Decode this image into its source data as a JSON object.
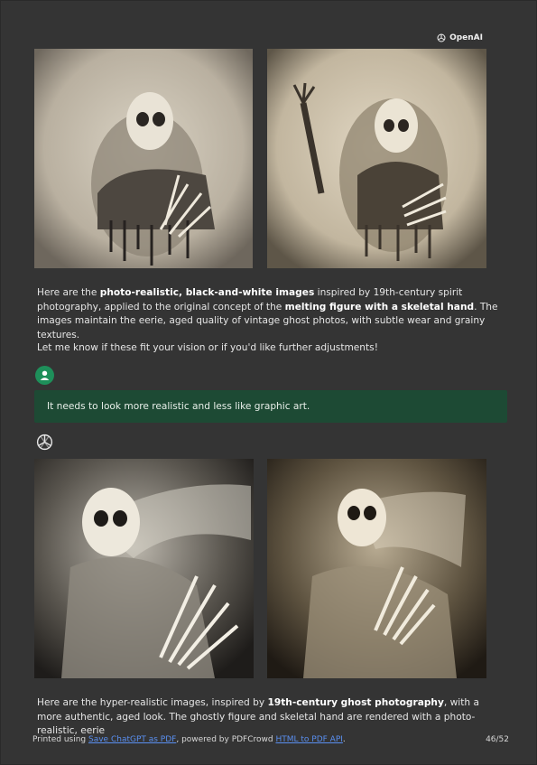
{
  "brand": {
    "name": "OpenAI",
    "icon": "openai-logo-icon"
  },
  "images_top": [
    {
      "alt": "melting skeletal figure ghost photo 1"
    },
    {
      "alt": "melting skeletal figure ghost photo 2"
    }
  ],
  "assistant_message_1": {
    "p1_a": "Here are the ",
    "p1_b": "photo-realistic, black-and-white images",
    "p1_c": " inspired by 19th-century spirit photography, applied to the original concept of the ",
    "p1_d": "melting figure with a skeletal hand",
    "p1_e": ". The images maintain the eerie, aged quality of vintage ghost photos, with subtle wear and grainy textures.",
    "p2": "Let me know if these fit your vision or if you'd like further adjustments!"
  },
  "user_message": {
    "text": "It needs to look more realistic and less like graphic art."
  },
  "images_bottom": [
    {
      "alt": "hyper-realistic ghost photo 1"
    },
    {
      "alt": "hyper-realistic ghost photo 2"
    }
  ],
  "assistant_message_2": {
    "p1_a": "Here are the hyper-realistic images, inspired by ",
    "p1_b": "19th-century ghost photography",
    "p1_c": ", with a more authentic, aged look. The ghostly figure and skeletal hand are rendered with a photo-realistic, eerie"
  },
  "footer": {
    "prefix": "Printed using ",
    "link1": "Save ChatGPT as PDF",
    "middle": ", powered by PDFCrowd ",
    "link2": "HTML to PDF API",
    "suffix": ".",
    "page": "46/52"
  },
  "colors": {
    "background": "#343434",
    "user_bubble": "#1d4a34",
    "user_avatar": "#1e8f5a",
    "link": "#5a8ff0"
  }
}
